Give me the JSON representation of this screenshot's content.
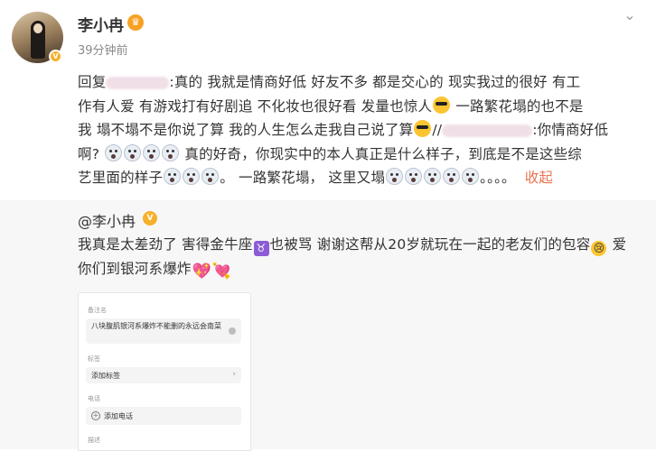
{
  "post": {
    "author": "李小冉",
    "time": "39分钟前",
    "reply_prefix": "回复",
    "line1_a": ":真的 我就是情商好低 好友不多 都是交心的 现实我过的很好 有工",
    "line2_a": "作有人爱 有游戏打有好剧追 不化妆也很好看 发量也惊人",
    "line2_b": " 一路繁花塌的也不是",
    "line3_a": "我 塌不塌不是你说了算 我的人生怎么走我自己说了算",
    "line3_b": "//",
    "line3_c": ":你情商好低",
    "line4_a": "啊? ",
    "line4_b": "  真的好奇，你现实中的本人真正是什么样子，到底是不是这些综",
    "line5_a": "艺里面的样子",
    "line5_b": "。 一路繁花塌， 这里又塌",
    "line5_c": "。。。。",
    "collapse": "收起"
  },
  "repost": {
    "author": "@李小冉",
    "text_a": "我真是太差劲了 害得金牛座",
    "text_b": "也被骂 谢谢这帮从20岁就玩在一起的老友们的包容",
    "text_c": " 爱",
    "text_d": "你们到银河系爆炸",
    "taurus_symbol": "♉"
  },
  "screenshot": {
    "label_remark": "备注名",
    "remark_value": "八块腹肌银河系爆炸不能删的永远会南菜",
    "label_tags": "标签",
    "add_tag": "添加标签",
    "label_phone": "电话",
    "add_phone": "添加电话",
    "label_desc": "描述"
  },
  "icons": {
    "more": "chevron-down-icon",
    "emoji_cool": "sunglasses-emoji-icon",
    "emoji_shock": "shocked-emoji-icon",
    "taurus": "taurus-zodiac-icon",
    "cry": "crying-emoji-icon",
    "heart": "heart-icon"
  },
  "colors": {
    "link": "#eb7350",
    "verified": "#f6b02a",
    "repost_bg": "#f7f7f7"
  }
}
